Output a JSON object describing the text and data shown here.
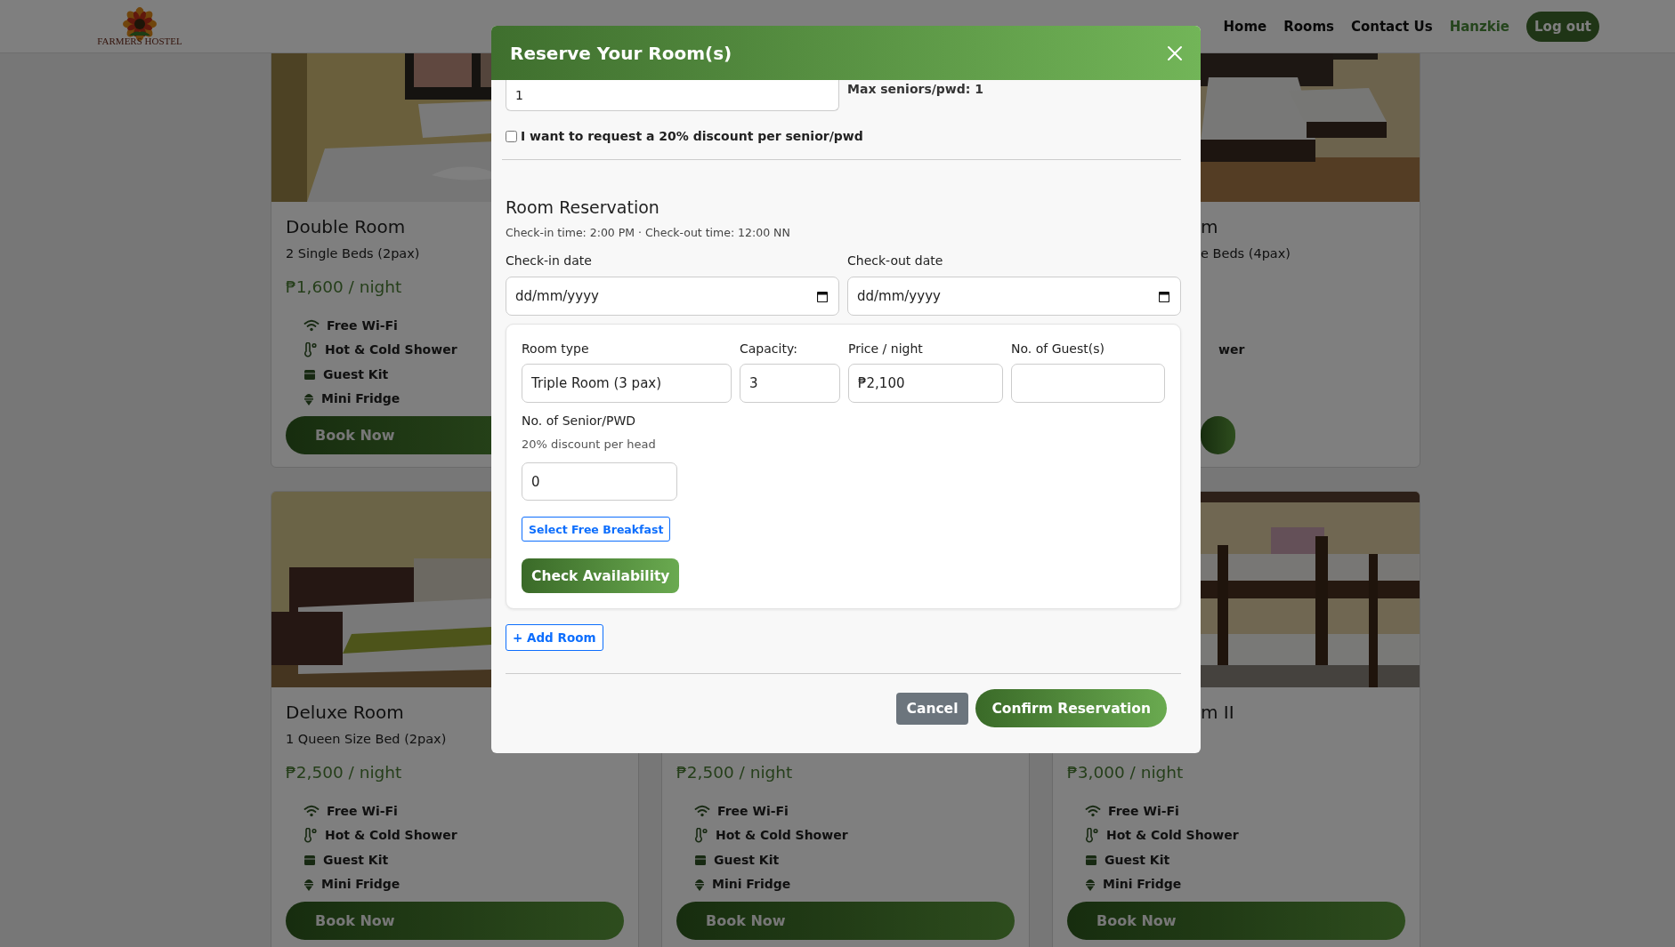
{
  "nav": {
    "logo": "FARMERS HOSTEL",
    "links": [
      {
        "label": "Home",
        "kind": "link"
      },
      {
        "label": "Rooms",
        "kind": "link"
      },
      {
        "label": "Contact Us",
        "kind": "link"
      },
      {
        "label": "Hanzkie",
        "kind": "user"
      }
    ],
    "logout": "Log out"
  },
  "cards": [
    {
      "title": "Double Room",
      "subtitle": "2 Single Beds (2pax)",
      "price": "₱1,600 / night",
      "amenities": [
        {
          "label": "Free Wi-Fi"
        },
        {
          "label": "Hot & Cold Shower"
        },
        {
          "label": "Guest Kit"
        },
        {
          "label": "Mini Fridge"
        }
      ],
      "button": "Book Now"
    },
    {
      "title": "m",
      "subtitle": "e Beds (4pax)",
      "amenities": [
        {
          "label": "wer"
        }
      ]
    },
    {
      "title": "Deluxe Room",
      "subtitle": "1 Queen Size Bed (2pax)",
      "price": "₱2,500 / night",
      "amenities": [
        {
          "label": "Free Wi-Fi"
        },
        {
          "label": "Hot & Cold Shower"
        },
        {
          "label": "Guest Kit"
        },
        {
          "label": "Mini Fridge"
        }
      ],
      "button": "Book Now"
    },
    {
      "price": "₱2,500 / night",
      "amenities": [
        {
          "label": "Free Wi-Fi"
        },
        {
          "label": "Hot & Cold Shower"
        },
        {
          "label": "Guest Kit"
        },
        {
          "label": "Mini Fridge"
        }
      ],
      "button": "Book Now"
    },
    {
      "title": "m II",
      "price": "₱3,000 / night",
      "amenities": [
        {
          "label": "Free Wi-Fi"
        },
        {
          "label": "Hot & Cold Shower"
        },
        {
          "label": "Guest Kit"
        },
        {
          "label": "Mini Fridge"
        }
      ],
      "button": "Book Now"
    }
  ],
  "modal": {
    "title": "Reserve Your Room(s)",
    "seniors_field": {
      "value": "1"
    },
    "max_seniors": "Max seniors/pwd: 1",
    "discount": {
      "label": "I want to request a 20% discount per senior/pwd",
      "checked": false
    },
    "section_title": "Room Reservation",
    "times": "Check-in time: 2:00 PM · Check-out time: 12:00 NN",
    "checkin": {
      "label": "Check-in date",
      "placeholder": "dd/mm/yyyy"
    },
    "checkout": {
      "label": "Check-out date",
      "placeholder": "dd/mm/yyyy"
    },
    "room": {
      "fields": [
        {
          "label": "Room type",
          "value": "Triple Room (3 pax)"
        },
        {
          "label": "Capacity:",
          "value": "3"
        },
        {
          "label": "Price / night",
          "value": "₱2,100"
        },
        {
          "label": "No. of Guest(s)"
        }
      ],
      "senior": {
        "label": "No. of Senior/PWD",
        "hint": "20% discount per head",
        "value": "0"
      },
      "breakfast_button": "Select Free Breakfast",
      "check_button": "Check Availability"
    },
    "add_room": "+ Add Room",
    "cancel": "Cancel",
    "confirm": "Confirm Reservation"
  }
}
